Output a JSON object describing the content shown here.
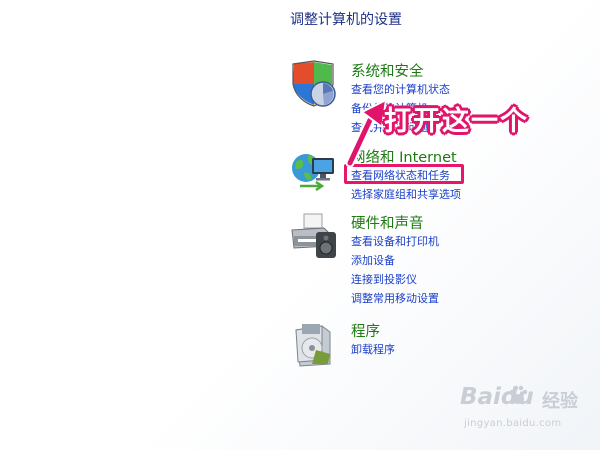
{
  "page_title": "调整计算机的设置",
  "categories": {
    "security": {
      "title": "系统和安全",
      "icon": "shield-icon",
      "links": [
        "查看您的计算机状态",
        "备份您的计算机",
        "查找并解决问题"
      ]
    },
    "network": {
      "title": "网络和 Internet",
      "icon": "network-icon",
      "links": [
        "查看网络状态和任务",
        "选择家庭组和共享选项"
      ]
    },
    "hardware": {
      "title": "硬件和声音",
      "icon": "printer-icon",
      "links": [
        "查看设备和打印机",
        "添加设备",
        "连接到投影仪",
        "调整常用移动设置"
      ]
    },
    "programs": {
      "title": "程序",
      "icon": "programs-icon",
      "links": [
        "卸载程序"
      ]
    }
  },
  "annotation": {
    "text": "打开这一个",
    "color": "#e0146a"
  },
  "watermark": {
    "logo": "Baidu",
    "logo_suffix": "经验",
    "url": "jingyan.baidu.com"
  },
  "colors": {
    "title": "#1e3287",
    "category_title": "#1e7b14",
    "link": "#1a3ec9",
    "annotation": "#e0146a"
  }
}
